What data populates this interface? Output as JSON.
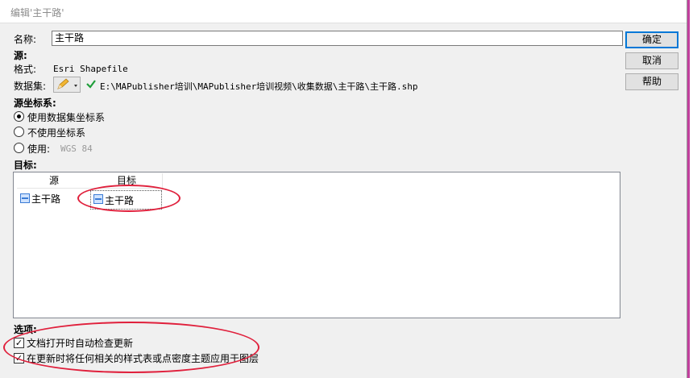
{
  "window": {
    "title": "编辑'主干路'"
  },
  "name_field": {
    "label": "名称:",
    "value": "主干路"
  },
  "buttons": {
    "ok": "确定",
    "cancel": "取消",
    "help": "帮助"
  },
  "source": {
    "heading": "源:",
    "format_label": "格式:",
    "format_value": "Esri Shapefile",
    "dataset_label": "数据集:",
    "dataset_path": "E:\\MAPublisher培训\\MAPublisher培训视频\\收集数据\\主干路\\主干路.shp",
    "status_icon": "green-check-icon",
    "edit_icon": "pencil-icon"
  },
  "source_crs": {
    "heading": "源坐标系:",
    "options": [
      {
        "label": "使用数据集坐标系",
        "selected": true
      },
      {
        "label": "不使用坐标系",
        "selected": false
      },
      {
        "label": "使用:",
        "selected": false,
        "value": "WGS 84"
      }
    ]
  },
  "target": {
    "heading": "目标:",
    "columns": [
      "源",
      "目标"
    ],
    "rows": [
      {
        "source": "主干路",
        "target": "主干路"
      }
    ]
  },
  "options": {
    "heading": "选项:",
    "items": [
      {
        "label": "文档打开时自动检查更新",
        "checked": true
      },
      {
        "label": "在更新时将任何相关的样式表或点密度主题应用于图层",
        "checked": true
      }
    ]
  },
  "colors": {
    "annotation_red": "#e0203c",
    "background_map_line": "#c040a0"
  }
}
